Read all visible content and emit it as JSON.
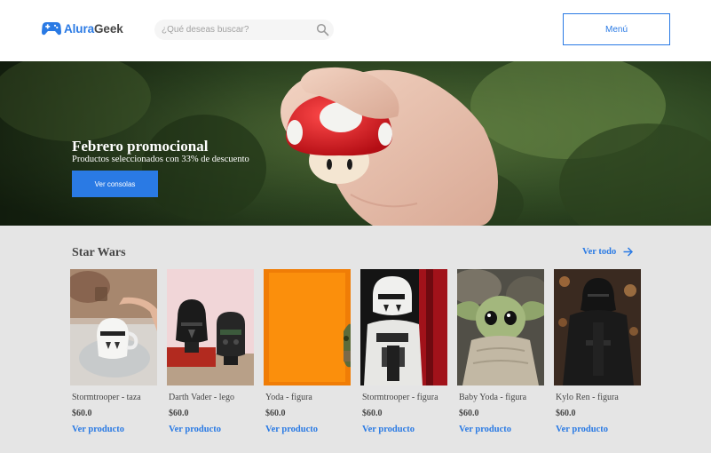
{
  "header": {
    "logo": {
      "prefix": "Alura",
      "suffix": "Geek",
      "icon": "gamepad-icon"
    },
    "search": {
      "placeholder": "¿Qué deseas buscar?",
      "value": "",
      "icon": "search-icon"
    },
    "menu_label": "Menú"
  },
  "banner": {
    "title": "Febrero promocional",
    "subtitle": "Productos seleccionados con 33% de descuento",
    "button_label": "Ver consolas",
    "image": "hand-holding-mushroom-toy"
  },
  "section": {
    "title": "Star Wars",
    "view_all_label": "Ver todo",
    "view_all_icon": "arrow-right-icon",
    "products": [
      {
        "name": "Stormtrooper - taza",
        "price": "$60.0",
        "link": "Ver producto",
        "image": "stormtrooper-mug-photo"
      },
      {
        "name": "Darth Vader - lego",
        "price": "$60.0",
        "link": "Ver producto",
        "image": "darth-vader-lego-photo"
      },
      {
        "name": "Yoda - figura",
        "price": "$60.0",
        "link": "Ver producto",
        "image": "yoda-figure-photo"
      },
      {
        "name": "Stormtrooper - figura",
        "price": "$60.0",
        "link": "Ver producto",
        "image": "stormtrooper-figure-photo"
      },
      {
        "name": "Baby Yoda - figura",
        "price": "$60.0",
        "link": "Ver producto",
        "image": "baby-yoda-figure-photo"
      },
      {
        "name": "Kylo Ren - figura",
        "price": "$60.0",
        "link": "Ver producto",
        "image": "kylo-ren-figure-photo"
      }
    ]
  },
  "colors": {
    "accent": "#2a7ae4",
    "text": "#464646",
    "section_background": "#e5e5e5",
    "search_background": "#f5f5f5"
  }
}
